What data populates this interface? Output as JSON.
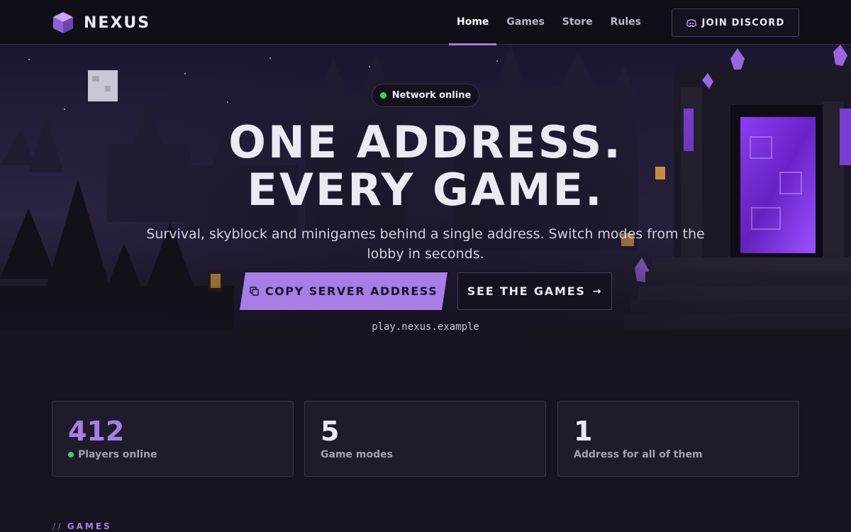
{
  "nav": {
    "brand": "NEXUS",
    "links": [
      {
        "label": "Home",
        "active": true
      },
      {
        "label": "Games",
        "active": false
      },
      {
        "label": "Store",
        "active": false
      },
      {
        "label": "Rules",
        "active": false
      }
    ],
    "discord_label": "JOIN DISCORD",
    "logo_icon": "cube-icon",
    "discord_icon": "discord-icon"
  },
  "hero": {
    "status": "Network online",
    "status_color": "#33d46a",
    "headline_line1": "ONE ADDRESS.",
    "headline_line2": "EVERY GAME.",
    "subtitle": "Survival, skyblock and minigames behind a single address. Switch modes from the lobby in seconds.",
    "copy_label": "COPY SERVER ADDRESS",
    "copy_icon": "copy-icon",
    "games_label": "SEE THE GAMES",
    "games_icon": "arrow-right-icon",
    "server_address": "play.nexus.example"
  },
  "stats": [
    {
      "value": "412",
      "label": "Players online",
      "online_dot": true
    },
    {
      "value": "5",
      "label": "Game modes"
    },
    {
      "value": "1",
      "label": "Address for all of them"
    }
  ],
  "section": {
    "slashes": "//",
    "label": "GAMES"
  },
  "colors": {
    "accent": "#a67ee6",
    "background": "#17131f",
    "online": "#33d46a"
  }
}
